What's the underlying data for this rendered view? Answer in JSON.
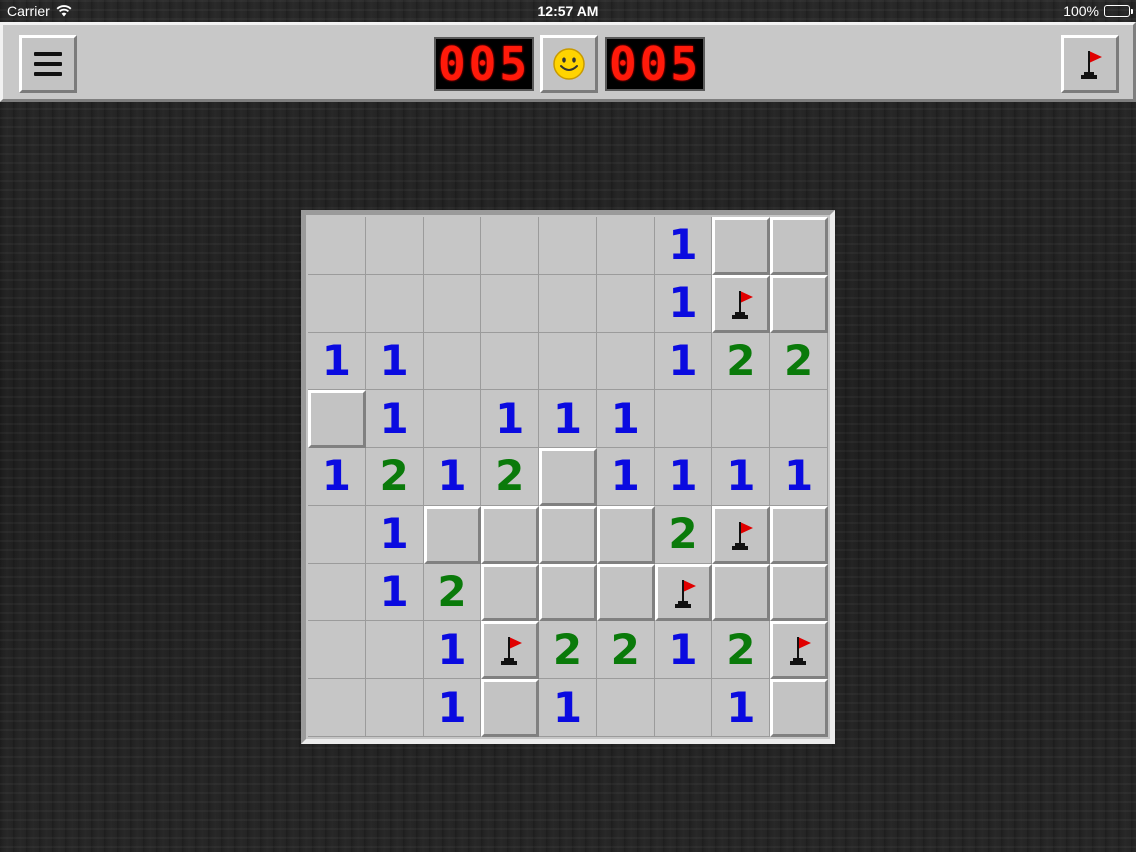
{
  "status_bar": {
    "carrier": "Carrier",
    "time": "12:57 AM",
    "battery": "100%"
  },
  "toolbar": {
    "mine_counter": "005",
    "timer": "005"
  },
  "colors": {
    "number_1": "#0a0ae0",
    "number_2": "#0a7a0a",
    "flag": "#e00000",
    "counter_digits": "#ff1a0a"
  },
  "icons": {
    "menu": "hamburger-icon",
    "face": "smiley-icon",
    "flag_mode": "flag-icon",
    "cell_flag": "flag-icon"
  },
  "board": {
    "legend": {
      ".": "revealed empty",
      "#": "unrevealed",
      "F": "flagged",
      "1-8": "revealed number"
    },
    "rows": [
      [
        ".",
        ".",
        ".",
        ".",
        ".",
        ".",
        "1",
        "#",
        "#"
      ],
      [
        ".",
        ".",
        ".",
        ".",
        ".",
        ".",
        "1",
        "F",
        "#"
      ],
      [
        "1",
        "1",
        ".",
        ".",
        ".",
        ".",
        "1",
        "2",
        "2"
      ],
      [
        "#",
        "1",
        ".",
        "1",
        "1",
        "1",
        ".",
        ".",
        "."
      ],
      [
        "1",
        "2",
        "1",
        "2",
        "#",
        "1",
        "1",
        "1",
        "1"
      ],
      [
        ".",
        "1",
        "#",
        "#",
        "#",
        "#",
        "2",
        "F",
        "#"
      ],
      [
        ".",
        "1",
        "2",
        "#",
        "#",
        "#",
        "F",
        "#",
        "#"
      ],
      [
        ".",
        ".",
        "1",
        "F",
        "2",
        "2",
        "1",
        "2",
        "F"
      ],
      [
        ".",
        ".",
        "1",
        "#",
        "1",
        ".",
        ".",
        "1",
        "#"
      ]
    ]
  }
}
